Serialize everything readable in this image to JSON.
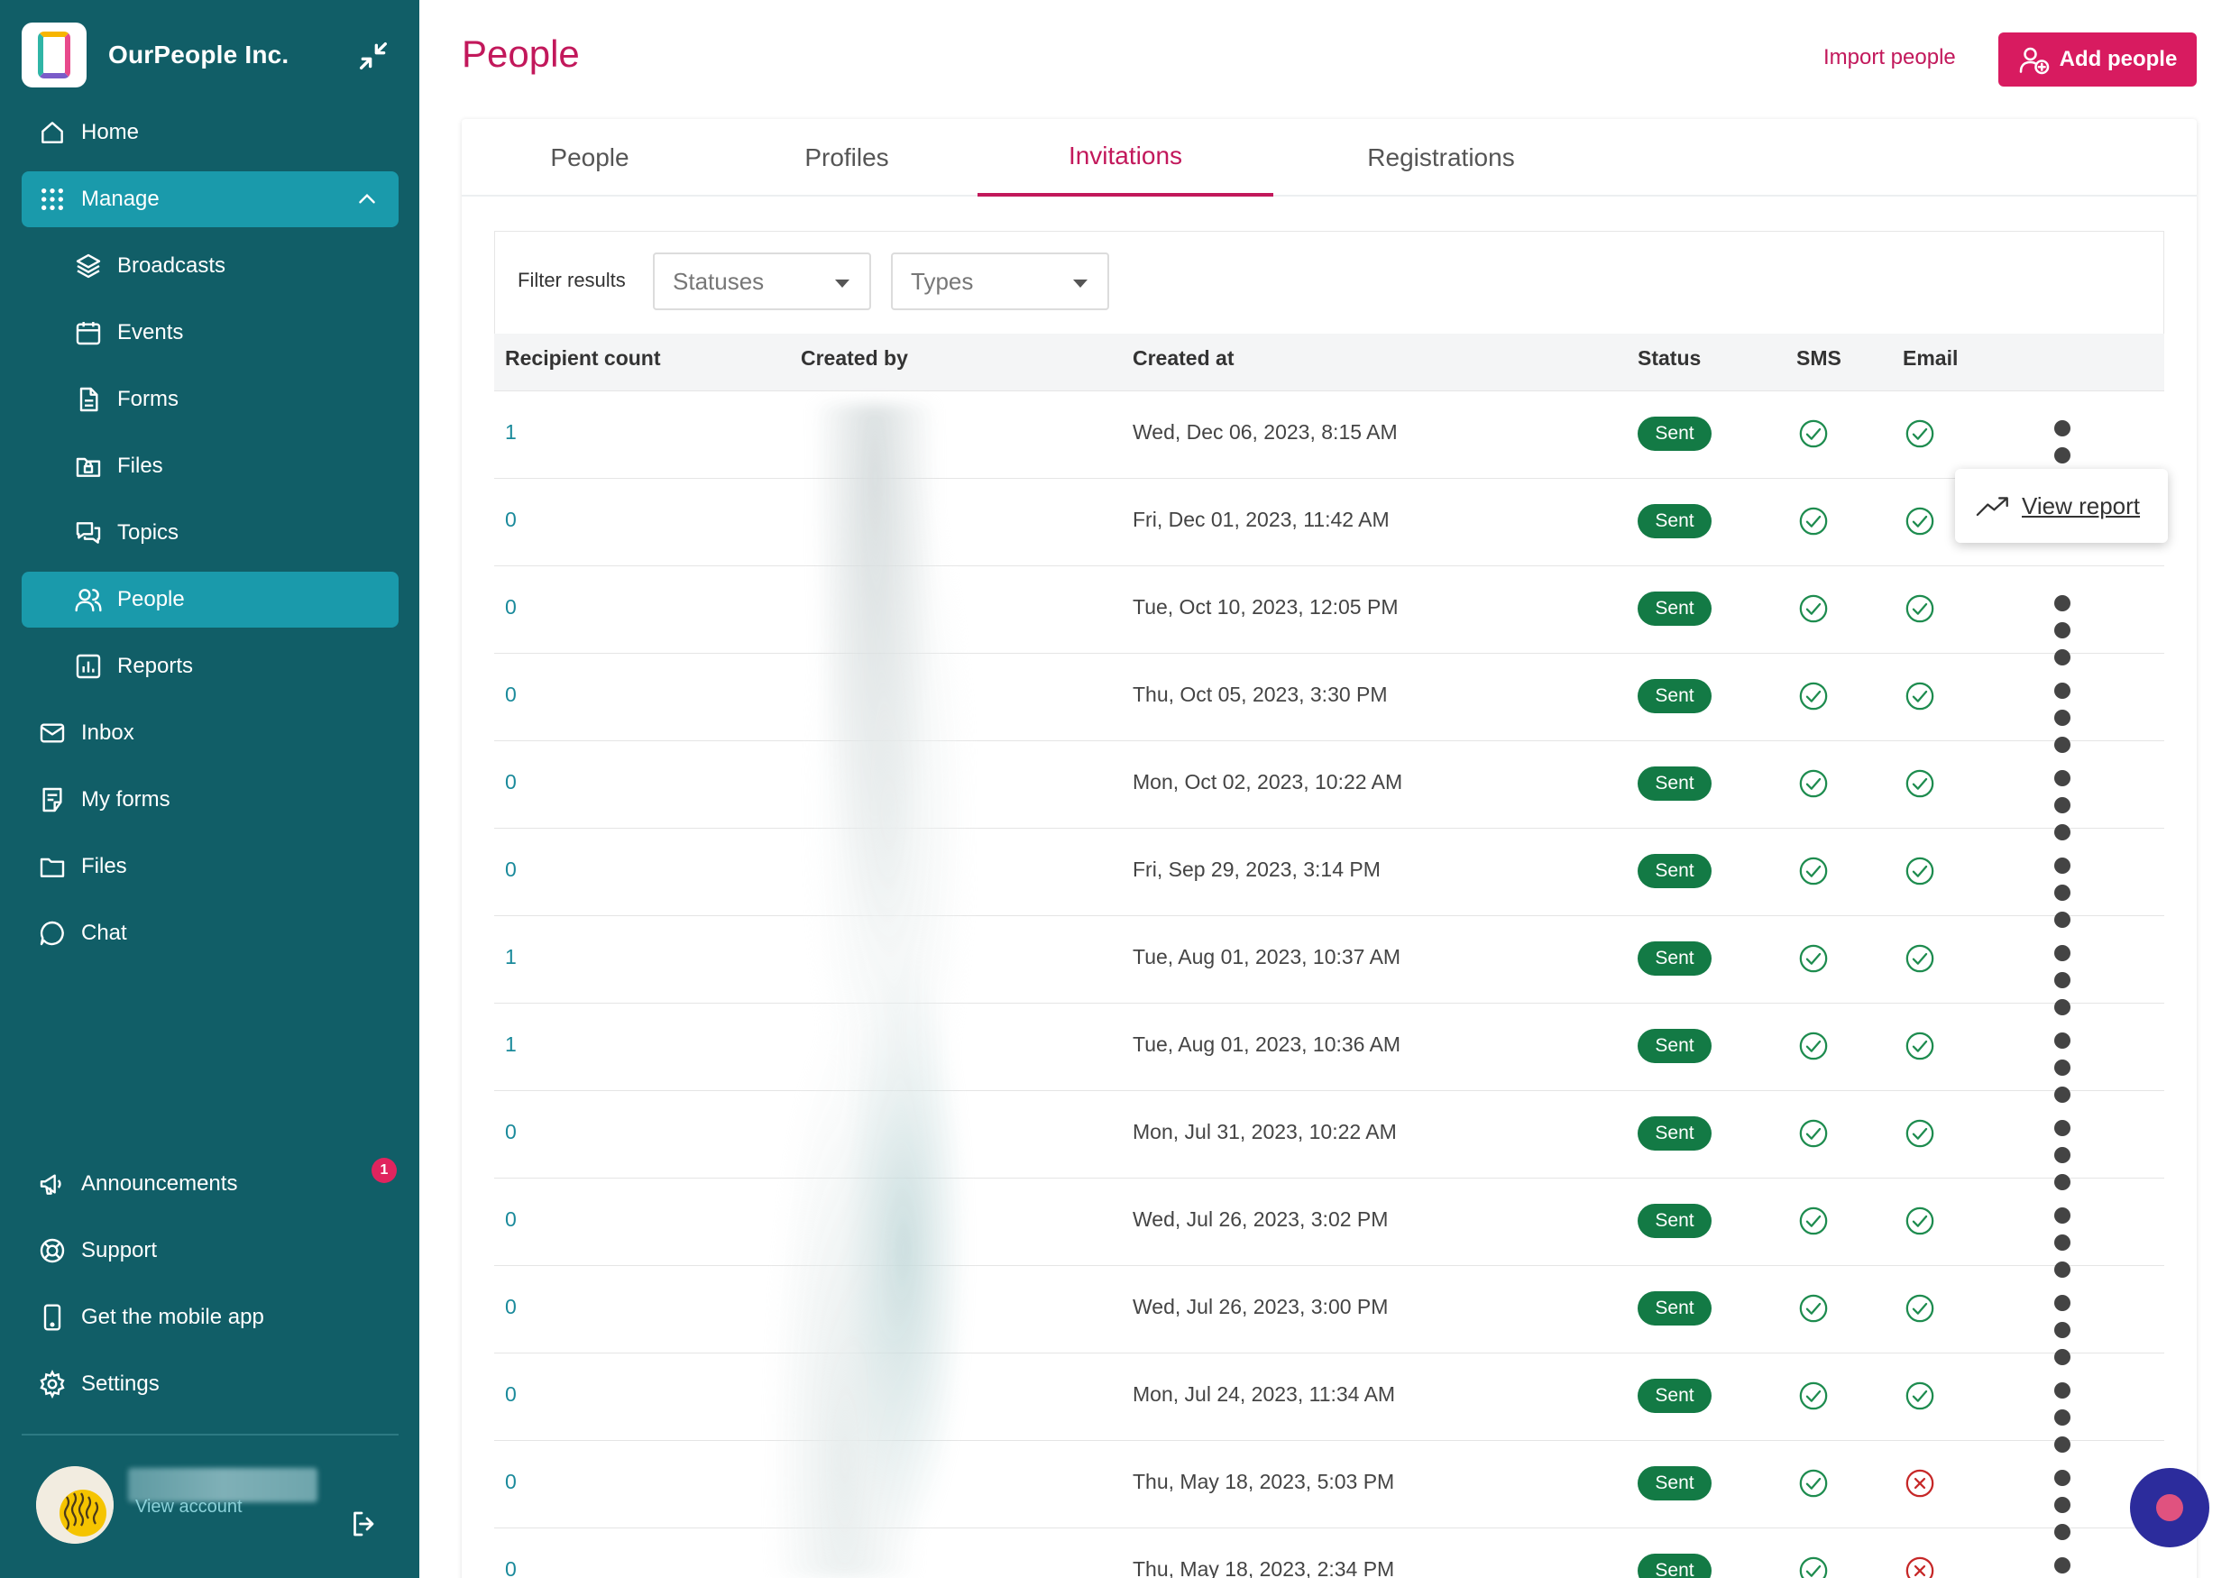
{
  "org": {
    "name": "OurPeople Inc."
  },
  "sidebar": {
    "items": [
      {
        "label": "Home",
        "icon": "home-icon"
      },
      {
        "label": "Manage",
        "icon": "grid-icon"
      },
      {
        "label": "Broadcasts",
        "icon": "layers-icon"
      },
      {
        "label": "Events",
        "icon": "calendar-icon"
      },
      {
        "label": "Forms",
        "icon": "document-icon"
      },
      {
        "label": "Files",
        "icon": "folder-lock-icon"
      },
      {
        "label": "Topics",
        "icon": "chat-bubbles-icon"
      },
      {
        "label": "People",
        "icon": "users-icon"
      },
      {
        "label": "Reports",
        "icon": "bar-chart-icon"
      },
      {
        "label": "Inbox",
        "icon": "mail-icon"
      },
      {
        "label": "My forms",
        "icon": "form-icon"
      },
      {
        "label": "Files",
        "icon": "folder-icon"
      },
      {
        "label": "Chat",
        "icon": "chat-icon"
      },
      {
        "label": "Announcements",
        "icon": "megaphone-icon"
      },
      {
        "label": "Support",
        "icon": "lifebuoy-icon"
      },
      {
        "label": "Get the mobile app",
        "icon": "phone-icon"
      },
      {
        "label": "Settings",
        "icon": "gear-icon"
      }
    ],
    "announcements_badge": "1",
    "view_account": "View account"
  },
  "header": {
    "title": "People",
    "import_label": "Import people",
    "add_label": "Add people"
  },
  "tabs": [
    {
      "label": "People"
    },
    {
      "label": "Profiles"
    },
    {
      "label": "Invitations",
      "active": true
    },
    {
      "label": "Registrations"
    }
  ],
  "filters": {
    "label": "Filter results",
    "statuses_placeholder": "Statuses",
    "types_placeholder": "Types"
  },
  "table": {
    "columns": [
      "Recipient count",
      "Created by",
      "Created at",
      "Status",
      "SMS",
      "Email"
    ],
    "rows": [
      {
        "count": "1",
        "created_at": "Wed, Dec 06, 2023, 8:15 AM",
        "status": "Sent",
        "sms": true,
        "email": true
      },
      {
        "count": "0",
        "created_at": "Fri, Dec 01, 2023, 11:42 AM",
        "status": "Sent",
        "sms": true,
        "email": true
      },
      {
        "count": "0",
        "created_at": "Tue, Oct 10, 2023, 12:05 PM",
        "status": "Sent",
        "sms": true,
        "email": true
      },
      {
        "count": "0",
        "created_at": "Thu, Oct 05, 2023, 3:30 PM",
        "status": "Sent",
        "sms": true,
        "email": true
      },
      {
        "count": "0",
        "created_at": "Mon, Oct 02, 2023, 10:22 AM",
        "status": "Sent",
        "sms": true,
        "email": true
      },
      {
        "count": "0",
        "created_at": "Fri, Sep 29, 2023, 3:14 PM",
        "status": "Sent",
        "sms": true,
        "email": true
      },
      {
        "count": "1",
        "created_at": "Tue, Aug 01, 2023, 10:37 AM",
        "status": "Sent",
        "sms": true,
        "email": true
      },
      {
        "count": "1",
        "created_at": "Tue, Aug 01, 2023, 10:36 AM",
        "status": "Sent",
        "sms": true,
        "email": true
      },
      {
        "count": "0",
        "created_at": "Mon, Jul 31, 2023, 10:22 AM",
        "status": "Sent",
        "sms": true,
        "email": true
      },
      {
        "count": "0",
        "created_at": "Wed, Jul 26, 2023, 3:02 PM",
        "status": "Sent",
        "sms": true,
        "email": true
      },
      {
        "count": "0",
        "created_at": "Wed, Jul 26, 2023, 3:00 PM",
        "status": "Sent",
        "sms": true,
        "email": true
      },
      {
        "count": "0",
        "created_at": "Mon, Jul 24, 2023, 11:34 AM",
        "status": "Sent",
        "sms": true,
        "email": true
      },
      {
        "count": "0",
        "created_at": "Thu, May 18, 2023, 5:03 PM",
        "status": "Sent",
        "sms": true,
        "email": false
      },
      {
        "count": "0",
        "created_at": "Thu, May 18, 2023, 2:34 PM",
        "status": "Sent",
        "sms": true,
        "email": false
      }
    ]
  },
  "popover": {
    "label": "View report",
    "icon": "trend-up-icon"
  },
  "colors": {
    "sidebar": "#115e67",
    "sidebar_active": "#1a9aab",
    "accent": "#d81b60",
    "link": "#1a8a9b",
    "sent": "#137a45",
    "check": "#1e8c4f",
    "error": "#c62828"
  }
}
